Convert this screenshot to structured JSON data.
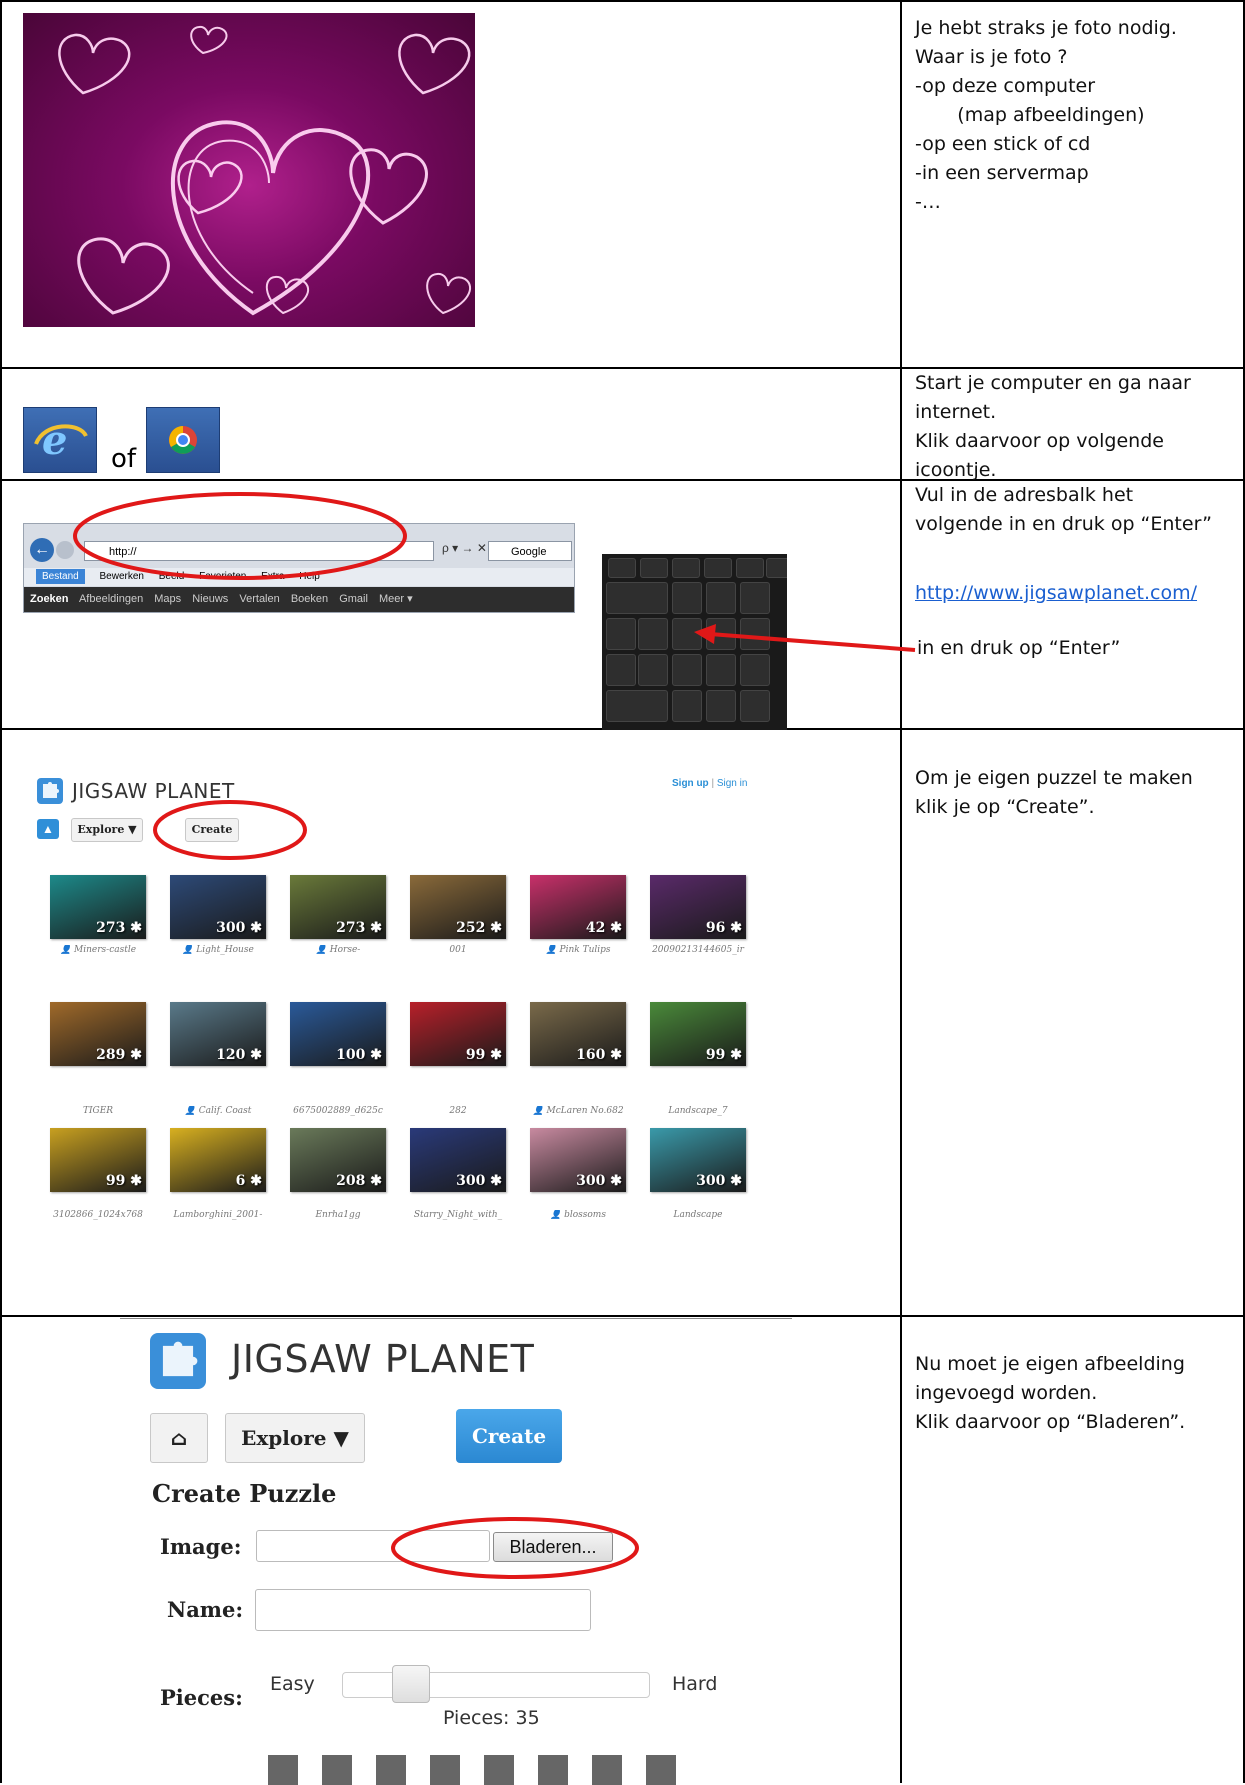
{
  "rows": [
    {
      "text": [
        "Je hebt straks je foto nodig.",
        "",
        "Waar is je foto ?",
        "-op deze computer",
        "       (map afbeeldingen)",
        "-op een stick of cd",
        "-in een servermap",
        "-…"
      ]
    },
    {
      "text": [
        "Start je computer en ga naar",
        "internet.",
        "Klik daarvoor op volgende",
        "icoontje."
      ],
      "or_word": "of"
    },
    {
      "text": [
        "Vul in de adresbalk het",
        "volgende in en druk op “Enter”"
      ],
      "link": "http://www.jigsawplanet.com/",
      "text2": "in en druk op “Enter”",
      "browser": {
        "address": "http://",
        "controls": "ρ ▾ → ✕",
        "google_box": "Google",
        "menu": [
          "Bestand",
          "Bewerken",
          "Beeld",
          "Favorieten",
          "Extra",
          "Help"
        ],
        "gbar": [
          "Zoeken",
          "Afbeeldingen",
          "Maps",
          "Nieuws",
          "Vertalen",
          "Boeken",
          "Gmail",
          "Meer ▾"
        ]
      }
    },
    {
      "text": [
        "Om je eigen puzzel te maken",
        "klik je op “Create”."
      ],
      "site": {
        "title": "JIGSAW PLANET",
        "explore": "Explore ▼",
        "create": "Create",
        "sign_up": "Sign up",
        "sep": "|",
        "sign_in": "Sign in"
      },
      "puzzles": [
        {
          "count": "273",
          "caption": "Miners-castle",
          "user": true,
          "color": "#1d8a8a"
        },
        {
          "count": "300",
          "caption": "Light_House",
          "user": true,
          "color": "#2d4a78"
        },
        {
          "count": "273",
          "caption": "Horse-",
          "user": true,
          "color": "#6a7a3a"
        },
        {
          "count": "252",
          "caption": "001",
          "user": false,
          "color": "#8a6a3a"
        },
        {
          "count": "42",
          "caption": "Pink Tulips",
          "user": true,
          "color": "#c8306a"
        },
        {
          "count": "96",
          "caption": "20090213144605_ir",
          "user": false,
          "color": "#5a2a6a"
        },
        {
          "count": "289",
          "caption": "TIGER",
          "user": false,
          "color": "#a06a2a"
        },
        {
          "count": "120",
          "caption": "Calif. Coast",
          "user": true,
          "color": "#5a7a8a"
        },
        {
          "count": "100",
          "caption": "6675002889_d625c",
          "user": false,
          "color": "#2a5a9a"
        },
        {
          "count": "99",
          "caption": "282",
          "user": false,
          "color": "#b8202a"
        },
        {
          "count": "160",
          "caption": "McLaren No.682",
          "user": true,
          "color": "#7a6a4a"
        },
        {
          "count": "99",
          "caption": "Landscape_7",
          "user": false,
          "color": "#4a8a3a"
        },
        {
          "count": "99",
          "caption": "3102866_1024x768",
          "user": false,
          "color": "#c8a020"
        },
        {
          "count": "6",
          "caption": "Lamborghini_2001-",
          "user": false,
          "color": "#d8b020"
        },
        {
          "count": "208",
          "caption": "Enrha1gg",
          "user": false,
          "color": "#6a7a5a"
        },
        {
          "count": "300",
          "caption": "Starry_Night_with_",
          "user": false,
          "color": "#2a3a7a"
        },
        {
          "count": "300",
          "caption": "blossoms",
          "user": true,
          "color": "#c88aa0"
        },
        {
          "count": "300",
          "caption": "Landscape",
          "user": false,
          "color": "#3a9aaa"
        }
      ]
    },
    {
      "text": [
        "Nu moet je eigen afbeelding",
        "ingevoegd worden.",
        "",
        "Klik daarvoor op “Bladeren”."
      ],
      "site": {
        "title": "JIGSAW PLANET",
        "explore": "Explore ▼",
        "create": "Create",
        "heading": "Create Puzzle",
        "image_label": "Image:",
        "browse": "Bladeren...",
        "name_label": "Name:",
        "pieces_label": "Pieces:",
        "easy": "Easy",
        "hard": "Hard",
        "pieces_count": "Pieces: 35"
      }
    }
  ],
  "colors": {
    "annotation_red": "#e01818",
    "link_blue": "#1a5fd0"
  }
}
